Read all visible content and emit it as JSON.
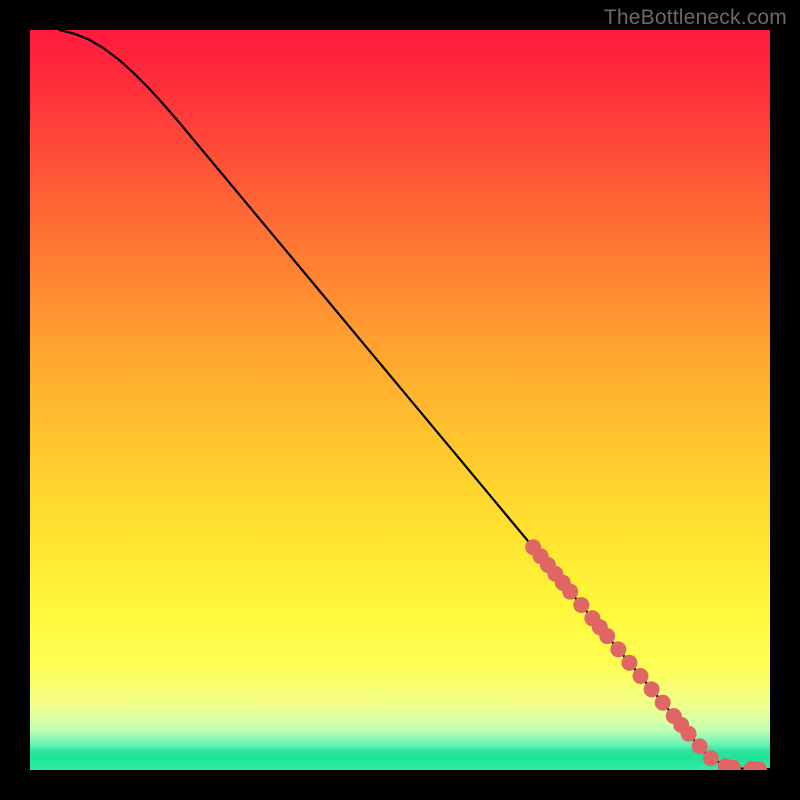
{
  "watermark": "TheBottleneck.com",
  "chart_data": {
    "type": "line",
    "title": "",
    "xlabel": "",
    "ylabel": "",
    "xlim": [
      0,
      100
    ],
    "ylim": [
      0,
      100
    ],
    "grid": false,
    "legend": false,
    "series": [
      {
        "name": "curve",
        "style": "line",
        "color": "#000000",
        "x": [
          4,
          6,
          8,
          10,
          12,
          14,
          16,
          18,
          20,
          25,
          30,
          35,
          40,
          45,
          50,
          55,
          60,
          65,
          70,
          73,
          75,
          78,
          80,
          82,
          84,
          85,
          86,
          87,
          88,
          89,
          90,
          91,
          92,
          94,
          96,
          98,
          100
        ],
        "values": [
          100,
          99.5,
          98.7,
          97.5,
          96,
          94.2,
          92.2,
          90,
          87.7,
          81.7,
          75.7,
          69.7,
          63.7,
          57.7,
          51.7,
          45.7,
          39.7,
          33.7,
          27.7,
          24.1,
          21.7,
          18.1,
          15.7,
          13.3,
          10.9,
          9.7,
          8.5,
          7.3,
          6.1,
          4.9,
          3.7,
          2.6,
          1.6,
          0.6,
          0.2,
          0.1,
          0.1
        ]
      },
      {
        "name": "markers",
        "style": "scatter",
        "color": "#e06666",
        "x": [
          68,
          69,
          70,
          71,
          72,
          73,
          74.5,
          76,
          77,
          78,
          79.5,
          81,
          82.5,
          84,
          85.5,
          87,
          88,
          89,
          90.5,
          92,
          94,
          95,
          97.5,
          98.5
        ],
        "values": [
          30.1,
          28.9,
          27.7,
          26.5,
          25.3,
          24.1,
          22.3,
          20.5,
          19.3,
          18.1,
          16.3,
          14.5,
          12.7,
          10.9,
          9.1,
          7.3,
          6.1,
          4.9,
          3.2,
          1.6,
          0.5,
          0.3,
          0.15,
          0.1
        ]
      }
    ]
  }
}
